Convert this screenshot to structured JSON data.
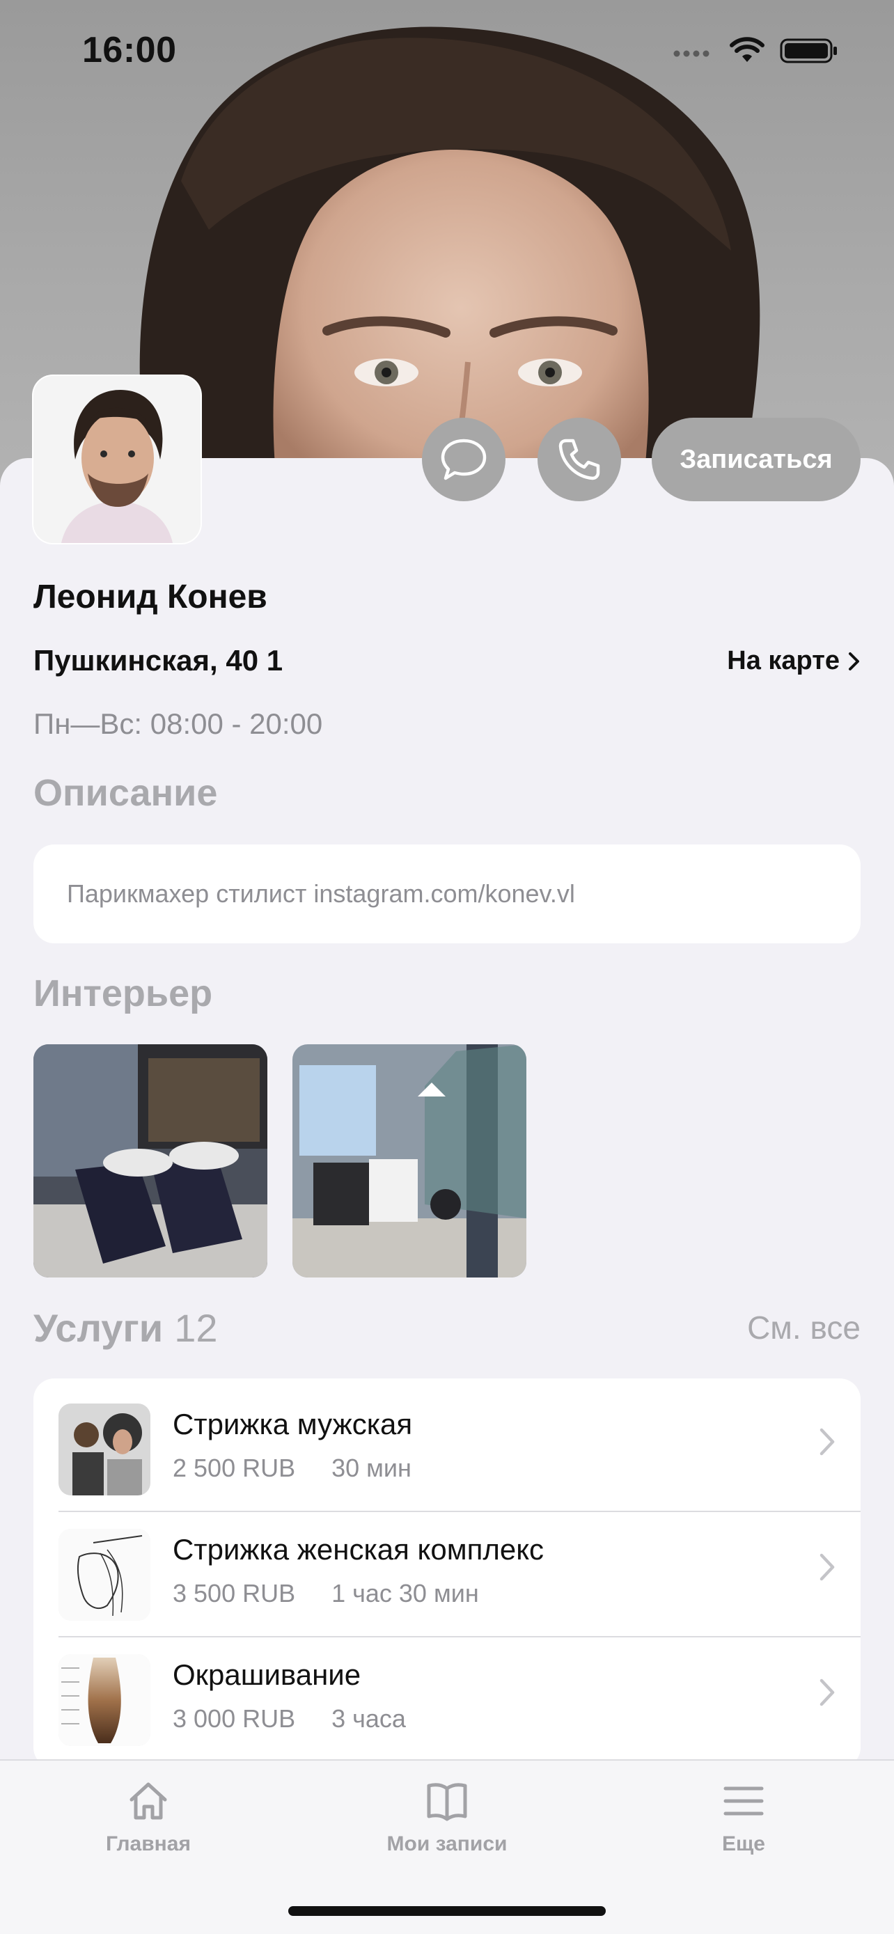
{
  "status_bar": {
    "time": "16:00"
  },
  "profile": {
    "name": "Леонид Конев",
    "address": "Пушкинская, 40 1",
    "map_link": "На карте",
    "hours": "Пн—Вс: 08:00 - 20:00",
    "book_button": "Записаться"
  },
  "description": {
    "title": "Описание",
    "text": "Парикмахер стилист instagram.com/konev.vl"
  },
  "interior": {
    "title": "Интерьер"
  },
  "services": {
    "title": "Услуги",
    "count": "12",
    "see_all": "См. все",
    "items": [
      {
        "name": "Стрижка мужская",
        "price": "2 500 RUB",
        "duration": "30 мин"
      },
      {
        "name": "Стрижка женская комплекс",
        "price": "3 500 RUB",
        "duration": "1 час 30 мин"
      },
      {
        "name": "Окрашивание",
        "price": "3 000 RUB",
        "duration": "3 часа"
      }
    ]
  },
  "tabbar": {
    "items": [
      {
        "label": "Главная",
        "icon": "home-icon"
      },
      {
        "label": "Мои записи",
        "icon": "book-icon"
      },
      {
        "label": "Еще",
        "icon": "menu-icon"
      }
    ]
  }
}
